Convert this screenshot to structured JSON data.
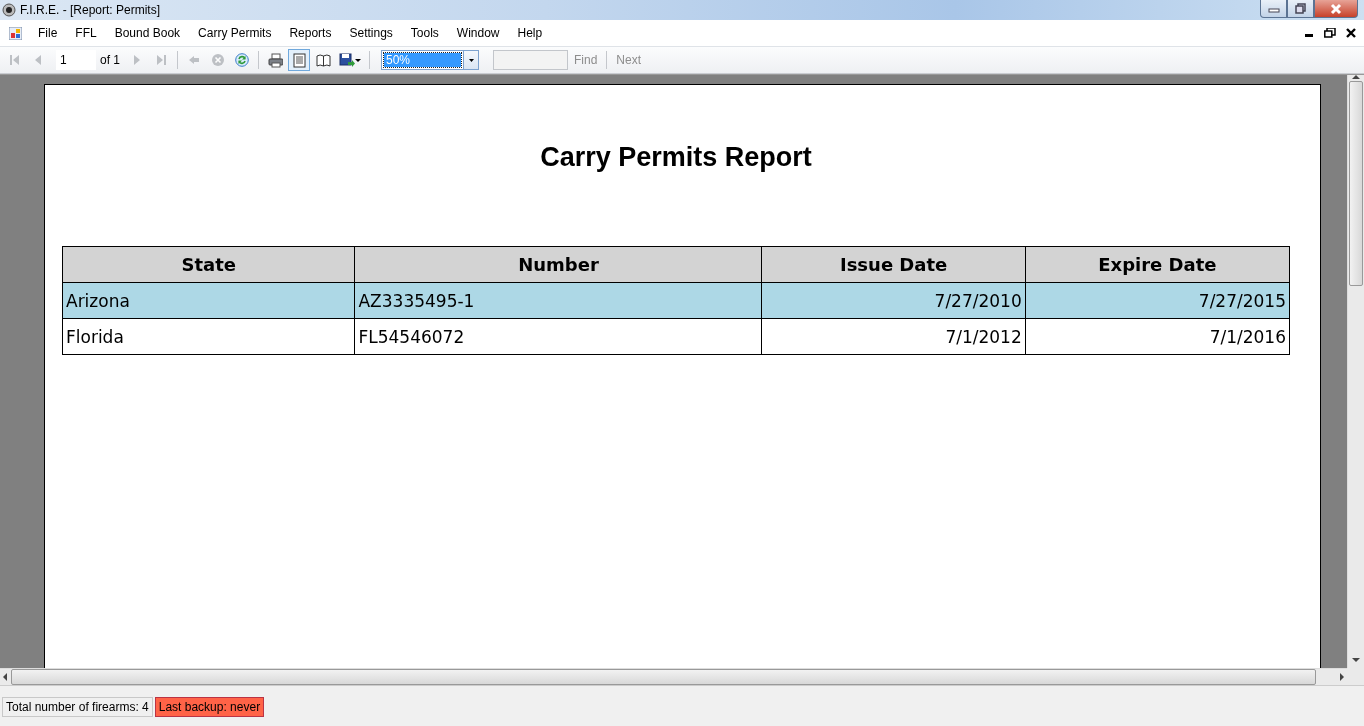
{
  "window": {
    "title": "F.I.R.E. - [Report: Permits]"
  },
  "menu": [
    "File",
    "FFL",
    "Bound Book",
    "Carry Permits",
    "Reports",
    "Settings",
    "Tools",
    "Window",
    "Help"
  ],
  "toolbar": {
    "nav_buttons": [
      {
        "kind": "first",
        "disabled": true
      },
      {
        "kind": "previous",
        "disabled": true
      }
    ],
    "page": "1",
    "page_count": "of 1",
    "nav_buttons_after": [
      {
        "kind": "next",
        "disabled": true
      },
      {
        "kind": "last",
        "disabled": true
      }
    ],
    "action_buttons": [
      {
        "kind": "back",
        "disabled": true
      },
      {
        "kind": "stop",
        "disabled": true
      },
      {
        "kind": "refresh",
        "disabled": false
      },
      {
        "kind": "print",
        "disabled": false
      },
      {
        "kind": "layout",
        "disabled": false
      },
      {
        "kind": "page-setup",
        "disabled": false
      },
      {
        "kind": "export",
        "disabled": false
      }
    ],
    "zoom": "50%",
    "find_button": "Find",
    "next_button": "Next"
  },
  "report": {
    "title": "Carry Permits Report",
    "table": {
      "columns": [
        "State",
        "Number",
        "Issue Date",
        "Expire Date"
      ],
      "rows": [
        {
          "cells": [
            "Arizona",
            "AZ3335495-1",
            "7/27/2010",
            "7/27/2015"
          ],
          "shaded": true
        },
        {
          "cells": [
            "Florida",
            "FL54546072",
            "7/1/2012",
            "7/1/2016"
          ],
          "shaded": false
        }
      ]
    }
  },
  "status_bar": [
    {
      "text": "Total number of firearms: 4",
      "kind": "info"
    },
    {
      "text": "Last backup: never",
      "kind": "warning"
    }
  ]
}
